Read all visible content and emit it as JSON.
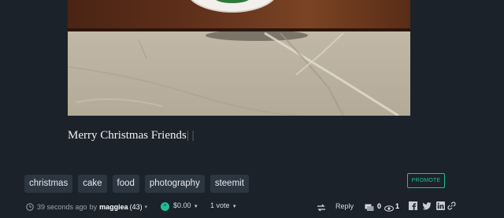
{
  "post": {
    "text": "Merry Christmas Friends",
    "text_suffix": "| |"
  },
  "tags": [
    "christmas",
    "cake",
    "food",
    "photography",
    "steemit"
  ],
  "promote_label": "PROMOTE",
  "meta": {
    "timestamp": "39 seconds ago",
    "by": "by",
    "author": "maggiea",
    "reputation": "(43)",
    "payout": "$0.00",
    "votes": "1 vote"
  },
  "actions": {
    "reply_label": "Reply",
    "comment_count": "0",
    "view_count": "1"
  },
  "colors": {
    "accent": "#1fbf9a",
    "background": "#1b222a",
    "tag_bg": "#2c3641"
  }
}
